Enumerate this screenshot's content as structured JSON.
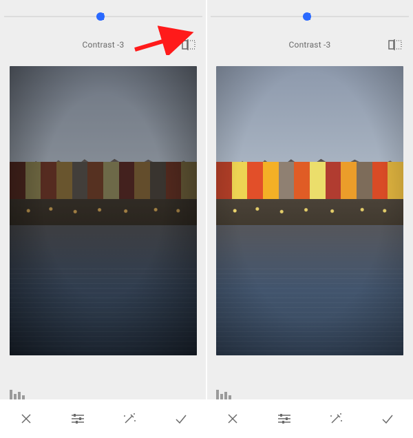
{
  "adjustment": {
    "name": "Contrast",
    "value": -3,
    "label": "Contrast -3"
  },
  "slider": {
    "min": -100,
    "max": 100,
    "value": -3,
    "thumb_pct": 48.5
  },
  "buildings": {
    "colors": [
      "#8a3a2a",
      "#c9b85e",
      "#b04a2f",
      "#c99a3a",
      "#7a7066",
      "#b0542e",
      "#c9c070",
      "#8a3830",
      "#c08a3a",
      "#6a5e52",
      "#a9462c",
      "#b89a4a"
    ]
  },
  "icons": {
    "compare": "compare-icon",
    "histogram": "histogram-icon",
    "cancel": "close-icon",
    "tune": "tune-icon",
    "autofix": "magic-wand-icon",
    "accept": "check-icon"
  },
  "annotation": {
    "arrow_color": "#ff1a1a"
  }
}
